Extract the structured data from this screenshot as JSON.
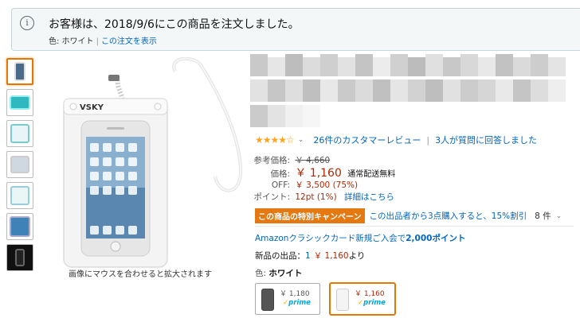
{
  "notice": {
    "icon": "info-icon",
    "title": "お客様は、2018/9/6にこの商品を注文しました。",
    "color_label": "色: ホワイト",
    "separator": "|",
    "view_order_link": "この注文を表示"
  },
  "gallery": {
    "thumbnail_count": 7,
    "selected_index": 0,
    "caption": "画像にマウスを合わせると拡大されます",
    "product_logo": "VSKY"
  },
  "product": {
    "rating": {
      "stars_icon": "★★★★☆",
      "chevron": "⌄",
      "reviews_link": "26件のカスタマーレビュー",
      "separator": "|",
      "questions_link": "3人が質問に回答しました"
    },
    "pricing": {
      "list_price_label": "参考価格:",
      "list_price": "￥ 4,660",
      "price_label": "価格:",
      "price": "￥ 1,160",
      "shipping_note": "通常配送無料",
      "off_label": "OFF:",
      "off_value": "￥ 3,500 (75%)",
      "points_label": "ポイント:",
      "points_value": "12pt  (1%)",
      "points_link": "詳細はこちら"
    },
    "promo": {
      "badge": "この商品の特別キャンペーン",
      "text": "この出品者から3点購入すると、15%割引",
      "count": "8 件",
      "chevron": "⌄"
    },
    "card_offer": {
      "text": "Amazonクラシックカード新規ご入会で",
      "points": "2,000ポイント"
    },
    "new_offers": {
      "prefix": "新品の出品：",
      "count_link": "1",
      "price": "￥ 1,160",
      "suffix": "より"
    },
    "color": {
      "label": "色:",
      "value": "ホワイト"
    },
    "swatches": [
      {
        "price": "￥ 1,180",
        "prime": "prime",
        "check": "✓",
        "selected": false
      },
      {
        "price": "￥ 1,160",
        "prime": "prime",
        "check": "✓",
        "selected": true
      }
    ]
  },
  "colors": {
    "link": "#0066c0",
    "price": "#b12704",
    "star": "#ffa41c",
    "promo_badge": "#e47911",
    "selected_border": "#e77600",
    "prime": "#00a8e1"
  }
}
